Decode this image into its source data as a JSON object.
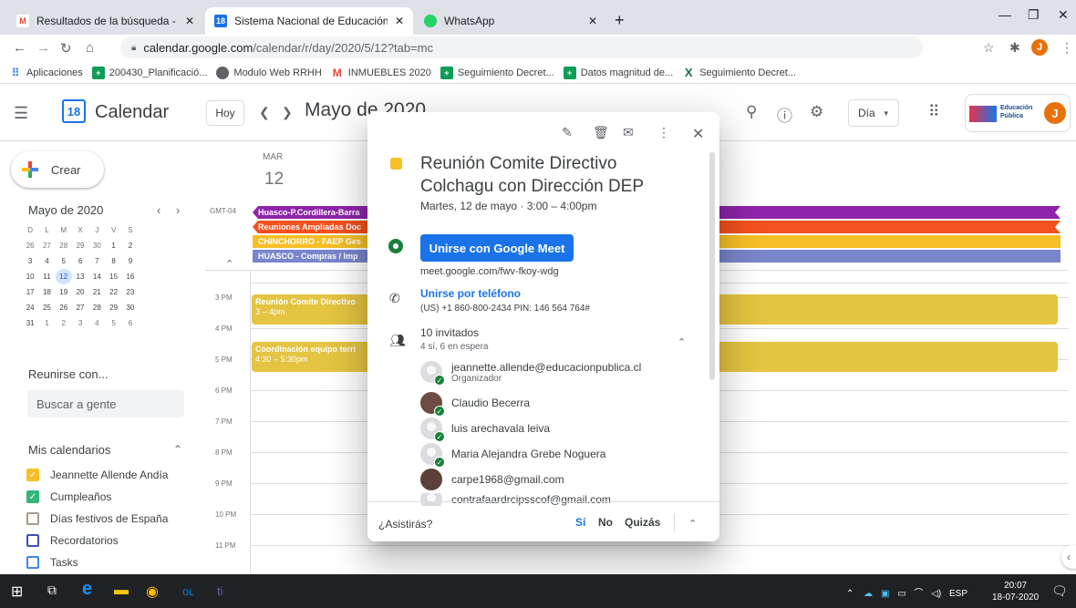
{
  "browser": {
    "tabs": [
      {
        "title": "Resultados de la búsqueda - jean",
        "icon": "gmail-icon",
        "color": "#ea4335",
        "glyph": "M"
      },
      {
        "title": "Sistema Nacional de Educación P",
        "icon": "calendar-icon",
        "color": "#1a73e8",
        "glyph": "18"
      },
      {
        "title": "WhatsApp",
        "icon": "whatsapp-icon",
        "color": "#25d366",
        "glyph": "◉"
      }
    ],
    "url_host": "calendar.google.com",
    "url_path": "/calendar/r/day/2020/5/12?tab=mc",
    "profile_initial": "J",
    "bookmarks": [
      {
        "label": "Aplicaciones",
        "icon": "apps-grid-icon",
        "color": "#4285f4",
        "glyph": "⠿"
      },
      {
        "label": "200430_Planificació...",
        "icon": "sheets-icon",
        "color": "#0f9d58",
        "glyph": "+"
      },
      {
        "label": "Modulo Web RRHH",
        "icon": "web-icon",
        "color": "#5f6368",
        "glyph": "◉"
      },
      {
        "label": "INMUEBLES 2020",
        "icon": "gmail-icon",
        "color": "#ea4335",
        "glyph": "M"
      },
      {
        "label": "Seguimiento Decret...",
        "icon": "sheets-icon",
        "color": "#0f9d58",
        "glyph": "+"
      },
      {
        "label": "Datos magnitud de...",
        "icon": "sheets-icon",
        "color": "#0f9d58",
        "glyph": "+"
      },
      {
        "label": "Seguimiento Decret...",
        "icon": "excel-icon",
        "color": "#1d6f42",
        "glyph": "X"
      }
    ]
  },
  "header": {
    "app_icon_day": "18",
    "app_title": "Calendar",
    "today_label": "Hoy",
    "month_title": "Mayo de 2020",
    "view_label": "Día",
    "org_logo_text": [
      "Educación",
      "Pública"
    ],
    "avatar_initial": "J"
  },
  "sidebar": {
    "create_label": "Crear",
    "mini_month": "Mayo de 2020",
    "weekdays": [
      "D",
      "L",
      "M",
      "X",
      "J",
      "V",
      "S"
    ],
    "weeks": [
      [
        "26",
        "27",
        "28",
        "29",
        "30",
        "1",
        "2"
      ],
      [
        "3",
        "4",
        "5",
        "6",
        "7",
        "8",
        "9"
      ],
      [
        "10",
        "11",
        "12",
        "13",
        "14",
        "15",
        "16"
      ],
      [
        "17",
        "18",
        "19",
        "20",
        "21",
        "22",
        "23"
      ],
      [
        "24",
        "25",
        "26",
        "27",
        "28",
        "29",
        "30"
      ],
      [
        "31",
        "1",
        "2",
        "3",
        "4",
        "5",
        "6"
      ]
    ],
    "selected_day": "12",
    "meet_with": "Reunirse con...",
    "search_people_placeholder": "Buscar a gente",
    "my_calendars": "Mis calendarios",
    "calendars": [
      {
        "name": "Jeannette Allende Andía",
        "checked": true,
        "color": "#f6bf26"
      },
      {
        "name": "Cumpleaños",
        "checked": true,
        "color": "#33b679"
      },
      {
        "name": "Días festivos de España",
        "checked": false,
        "color": "#a79b8e"
      },
      {
        "name": "Recordatorios",
        "checked": false,
        "color": "#3f51b5"
      },
      {
        "name": "Tasks",
        "checked": false,
        "color": "#4285f4"
      }
    ]
  },
  "day": {
    "weekday": "MAR",
    "date": "12",
    "timezone": "GMT-04",
    "hours": [
      "3 PM",
      "4 PM",
      "5 PM",
      "6 PM",
      "7 PM",
      "8 PM",
      "9 PM",
      "10 PM",
      "11 PM"
    ],
    "all_day": [
      {
        "title": "Huasco-P.Cordillera-Barra",
        "color": "#8e24aa"
      },
      {
        "title": "Reuniones Ampliadas Doc",
        "color": "#f4511e"
      },
      {
        "title": "CHINCHORRO - FAEP Ges",
        "color": "#f6bf26"
      },
      {
        "title": "HUASCO - Compras / Imp",
        "color": "#7986cb"
      }
    ],
    "events": [
      {
        "title": "Reunión Comite Directivo",
        "time": "3 – 4pm",
        "color": "#e4c441"
      },
      {
        "title": "Coordinación equipo terri",
        "time": "4:30 – 5:30pm",
        "color": "#e4c441"
      }
    ]
  },
  "popup": {
    "title": "Reunión Comite Directivo Colchagu con Dirección DEP",
    "date": "Martes, 12 de mayo  ·  3:00 – 4:00pm",
    "meet_button": "Unirse con Google Meet",
    "meet_link": "meet.google.com/fwv-fkoy-wdg",
    "phone_title": "Unirse por teléfono",
    "phone_detail": "(US) +1 860-800-2434 PIN: 146 564 764#",
    "guests_count": "10 invitados",
    "guests_status": "4 sí, 6 en espera",
    "guests": [
      {
        "name": "jeannette.allende@educacionpublica.cl",
        "role": "Organizador",
        "avatar_color": "#dadce0",
        "photo": false
      },
      {
        "name": "Claudio Becerra",
        "role": "",
        "avatar_color": "#6d4c41",
        "photo": true
      },
      {
        "name": "luis arechavala leiva",
        "role": "",
        "avatar_color": "#dadce0",
        "photo": false
      },
      {
        "name": "Maria Alejandra Grebe Noguera",
        "role": "",
        "avatar_color": "#dadce0",
        "photo": false
      },
      {
        "name": "carpe1968@gmail.com",
        "role": "",
        "avatar_color": "#5d4037",
        "photo": true
      },
      {
        "name": "contrafaardrcipsscof@gmail.com",
        "role": "",
        "avatar_color": "#dadce0",
        "photo": false
      }
    ],
    "rsvp_question": "¿Asistirás?",
    "rsvp_yes": "Sí",
    "rsvp_no": "No",
    "rsvp_maybe": "Quizás"
  },
  "taskbar": {
    "lang": "ESP",
    "time": "20:07",
    "date": "18-07-2020",
    "notif_count": "1"
  },
  "colors": {
    "accent": "#1a73e8",
    "event_yellow": "#e4c441"
  }
}
